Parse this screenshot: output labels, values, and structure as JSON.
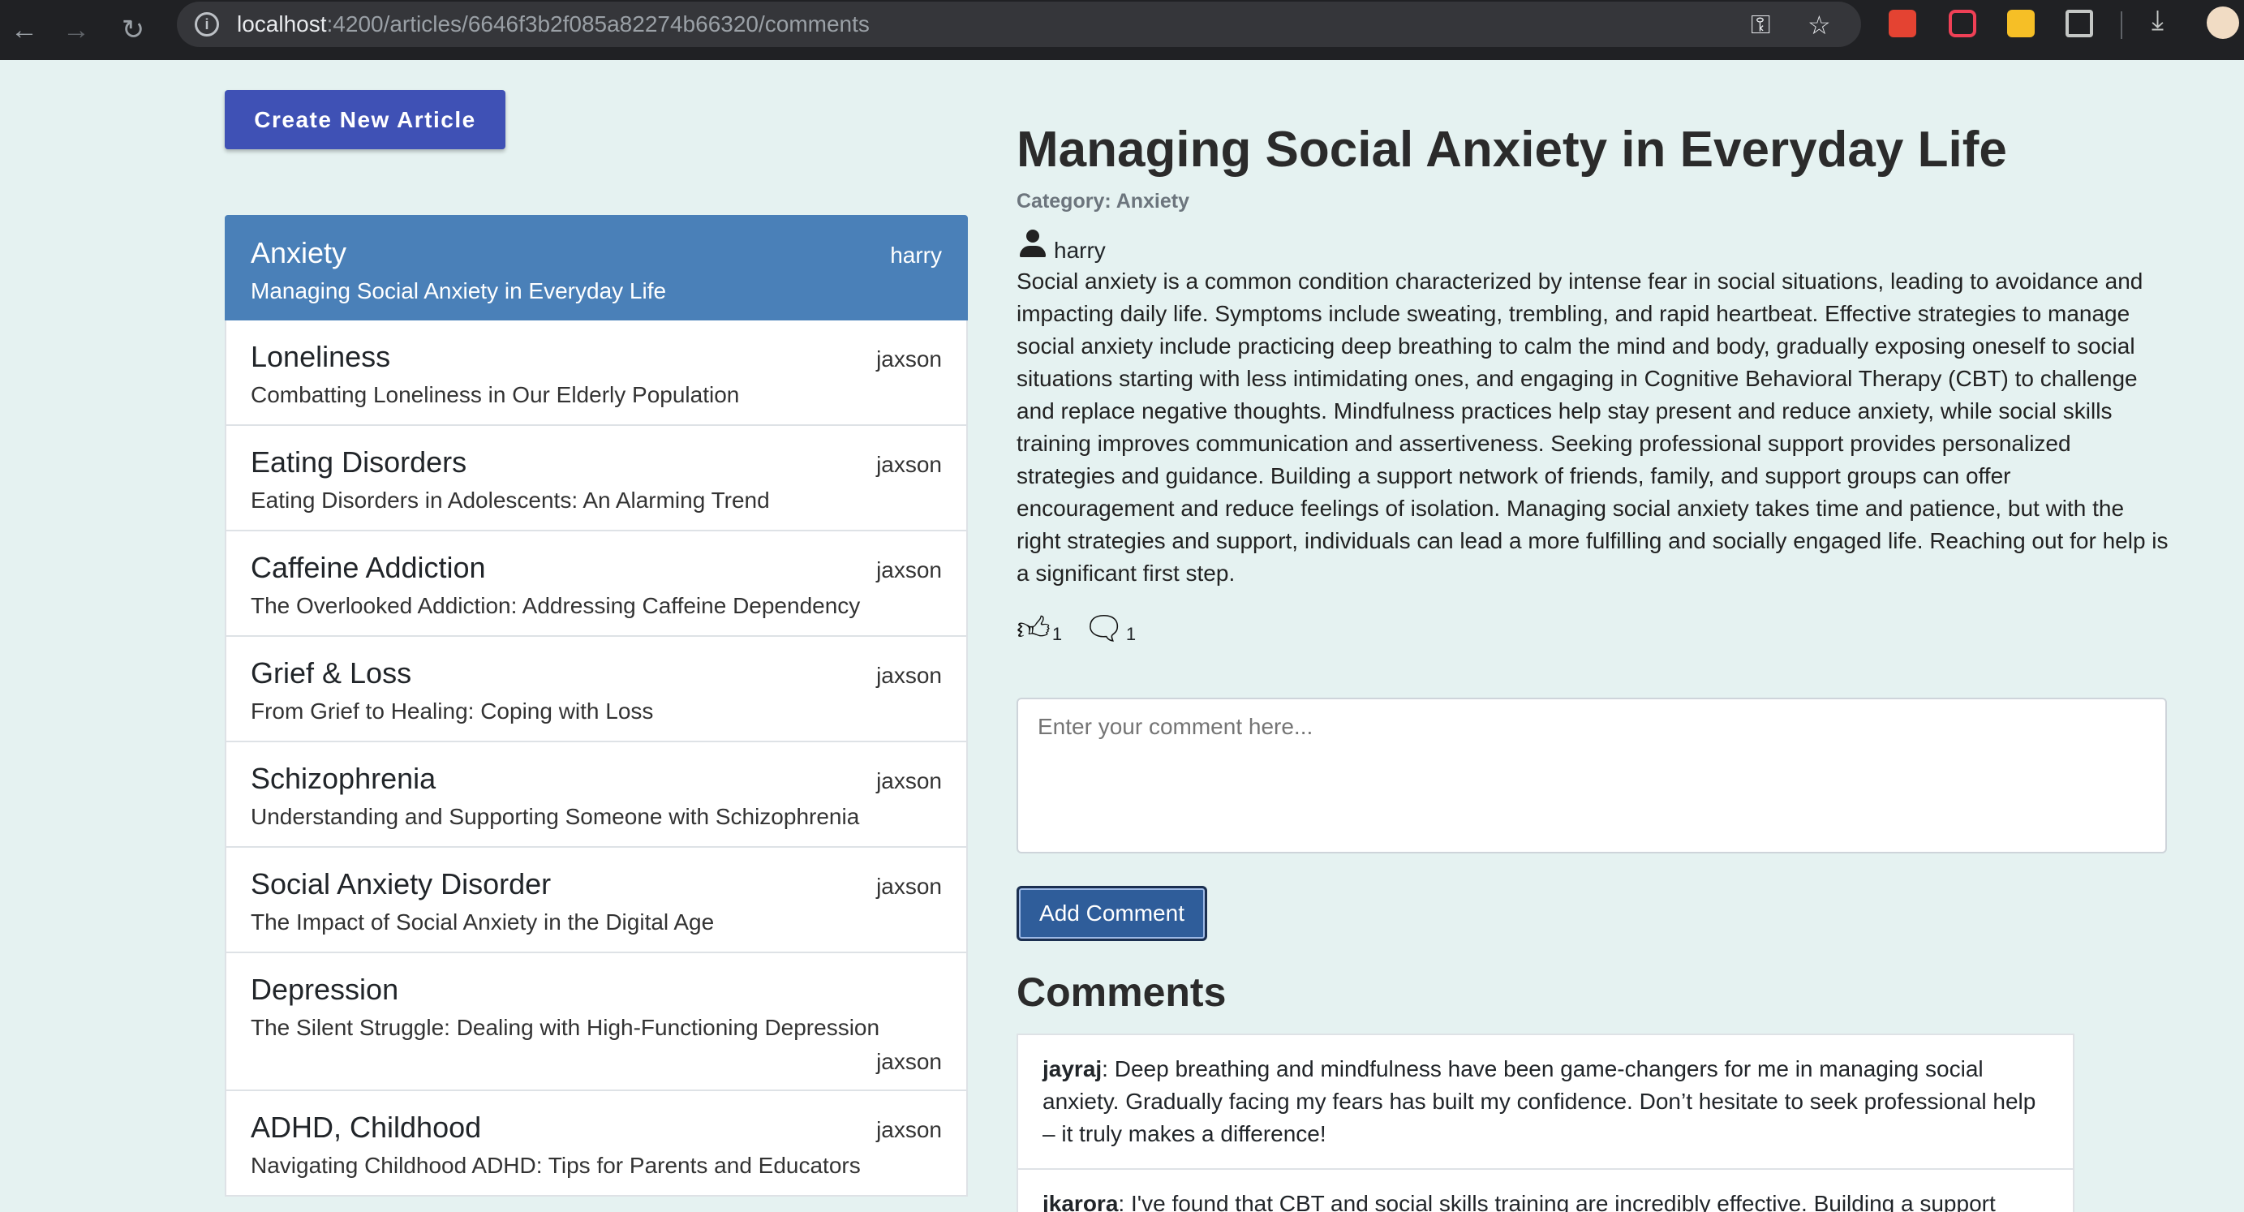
{
  "browser": {
    "url_host": "localhost",
    "url_path": ":4200/articles/6646f3b2f085a82274b66320/comments"
  },
  "create_button": "Create New Article",
  "categories": [
    {
      "title": "Anxiety",
      "subtitle": "Managing Social Anxiety in Everyday Life",
      "author": "harry",
      "active": true
    },
    {
      "title": "Loneliness",
      "subtitle": "Combatting Loneliness in Our Elderly Population",
      "author": "jaxson"
    },
    {
      "title": "Eating Disorders",
      "subtitle": "Eating Disorders in Adolescents: An Alarming Trend",
      "author": "jaxson"
    },
    {
      "title": "Caffeine Addiction",
      "subtitle": "The Overlooked Addiction: Addressing Caffeine Dependency",
      "author": "jaxson"
    },
    {
      "title": "Grief & Loss",
      "subtitle": "From Grief to Healing: Coping with Loss",
      "author": "jaxson"
    },
    {
      "title": "Schizophrenia",
      "subtitle": "Understanding and Supporting Someone with Schizophrenia",
      "author": "jaxson"
    },
    {
      "title": "Social Anxiety Disorder",
      "subtitle": "The Impact of Social Anxiety in the Digital Age",
      "author": "jaxson"
    },
    {
      "title": "Depression",
      "subtitle": "The Silent Struggle: Dealing with High-Functioning Depression",
      "author": "jaxson"
    },
    {
      "title": "ADHD, Childhood",
      "subtitle": "Navigating Childhood ADHD: Tips for Parents and Educators",
      "author": "jaxson"
    }
  ],
  "article": {
    "title": "Managing Social Anxiety in Everyday Life",
    "category": "Category: Anxiety",
    "author": "harry",
    "body": "Social anxiety is a common condition characterized by intense fear in social situations, leading to avoidance and impacting daily life. Symptoms include sweating, trembling, and rapid heartbeat. Effective strategies to manage social anxiety include practicing deep breathing to calm the mind and body, gradually exposing oneself to social situations starting with less intimidating ones, and engaging in Cognitive Behavioral Therapy (CBT) to challenge and replace negative thoughts. Mindfulness practices help stay present and reduce anxiety, while social skills training improves communication and assertiveness. Seeking professional support provides personalized strategies and guidance. Building a support network of friends, family, and support groups can offer encouragement and reduce feelings of isolation. Managing social anxiety takes time and patience, but with the right strategies and support, individuals can lead a more fulfilling and socially engaged life. Reaching out for help is a significant first step.",
    "likes": "1",
    "comment_count": "1"
  },
  "comment_form": {
    "placeholder": "Enter your comment here...",
    "submit_label": "Add Comment"
  },
  "comments_heading": "Comments",
  "comments": [
    {
      "user": "jayraj",
      "text": ": Deep breathing and mindfulness have been game-changers for me in managing social anxiety. Gradually facing my fears has built my confidence. Don’t hesitate to seek professional help – it truly makes a difference!"
    },
    {
      "user": "jkarora",
      "text": ": I've found that CBT and social skills training are incredibly effective. Building a support"
    }
  ]
}
